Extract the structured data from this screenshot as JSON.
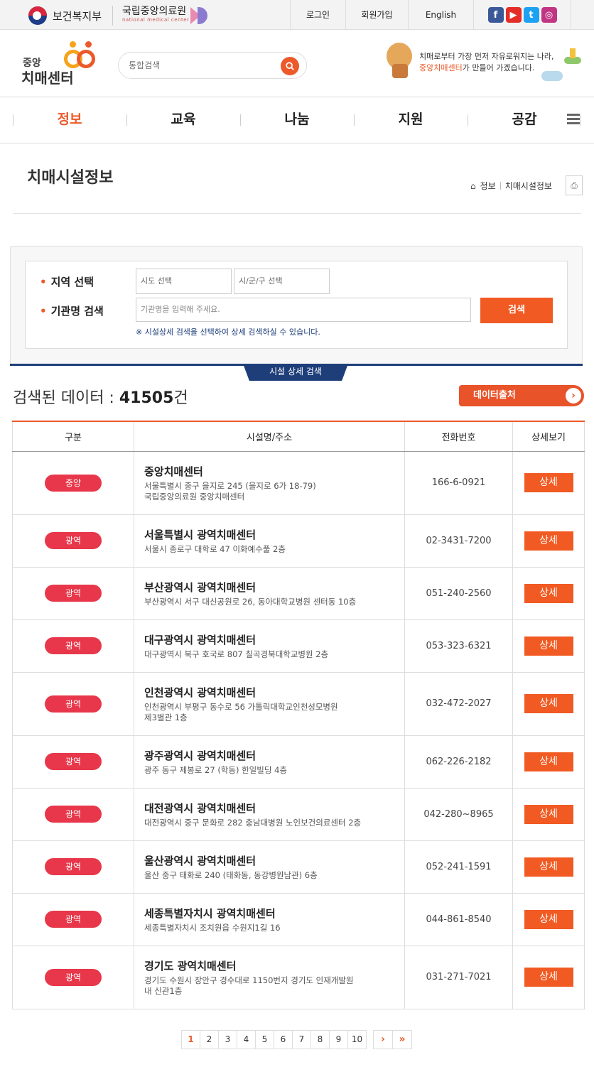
{
  "topbar": {
    "gov_name": "보건복지부",
    "nmc_name": "국립중앙의료원",
    "nmc_sub": "national medical center",
    "links": [
      "로그인",
      "회원가입",
      "English"
    ],
    "social": [
      {
        "icon": "facebook-icon",
        "glyph": "f"
      },
      {
        "icon": "youtube-icon",
        "glyph": "▶"
      },
      {
        "icon": "twitter-icon",
        "glyph": "t"
      },
      {
        "icon": "instagram-icon",
        "glyph": "◎"
      }
    ]
  },
  "header": {
    "logo_small": "중앙",
    "logo_big": "치매센터",
    "search_placeholder": "통합검색",
    "promo_line1": "치매로부터 가장 먼저 자유로워지는 나라,",
    "promo_highlight": "중앙치매센터",
    "promo_line2_rest": "가 만들어 가겠습니다."
  },
  "gnb": {
    "items": [
      "정보",
      "교육",
      "나눔",
      "지원",
      "공감"
    ],
    "active_index": 0
  },
  "page": {
    "title": "치매시설정보",
    "breadcrumb": [
      "정보",
      "치매시설정보"
    ]
  },
  "search_form": {
    "region_label": "지역 선택",
    "sido_placeholder": "시도 선택",
    "sigungu_placeholder": "시/군/구 선택",
    "org_label": "기관명 검색",
    "org_placeholder": "기관명을 입력해 주세요.",
    "search_button": "검색",
    "note": "※ 시설상세 검색을 선택하여 상세 검색하실 수 있습니다.",
    "detail_tab": "시설 상세 검색"
  },
  "results": {
    "count_prefix": "검색된 데이터 : ",
    "count_value": "41505",
    "count_suffix": "건",
    "export_label": "데이터출처",
    "columns": [
      "구분",
      "시설명/주소",
      "전화번호",
      "상세보기"
    ],
    "detail_label": "상세",
    "rows": [
      {
        "type": "중앙",
        "name": "중앙치매센터",
        "addr1": "서울특별시 중구 을지로 245 (을지로 6가 18-79)",
        "addr2": "국립중앙의료원 중앙치매센터",
        "phone": "166-6-0921"
      },
      {
        "type": "광역",
        "name": "서울특별시 광역치매센터",
        "addr1": "서울시 종로구 대학로 47 이화예수풀 2층",
        "addr2": "",
        "phone": "02-3431-7200"
      },
      {
        "type": "광역",
        "name": "부산광역시 광역치매센터",
        "addr1": "부산광역시 서구 대신공원로 26, 동아대학교병원 센터동 10층",
        "addr2": "",
        "phone": "051-240-2560"
      },
      {
        "type": "광역",
        "name": "대구광역시 광역치매센터",
        "addr1": "대구광역시 북구 호국로 807 칠곡경북대학교병원 2층",
        "addr2": "",
        "phone": "053-323-6321"
      },
      {
        "type": "광역",
        "name": "인천광역시 광역치매센터",
        "addr1": "인천광역시 부평구 동수로 56 가톨릭대학교인천성모병원",
        "addr2": "제3별관 1층",
        "phone": "032-472-2027"
      },
      {
        "type": "광역",
        "name": "광주광역시 광역치매센터",
        "addr1": "광주 동구 제봉로 27 (학동) 한일빌딩 4층",
        "addr2": "",
        "phone": "062-226-2182"
      },
      {
        "type": "광역",
        "name": "대전광역시 광역치매센터",
        "addr1": "대전광역시 중구 문화로 282 충남대병원 노인보건의료센터 2층",
        "addr2": "",
        "phone": "042-280~8965"
      },
      {
        "type": "광역",
        "name": "울산광역시 광역치매센터",
        "addr1": "울산 중구 태화로 240 (태화동, 동강병원남관) 6층",
        "addr2": "",
        "phone": "052-241-1591"
      },
      {
        "type": "광역",
        "name": "세종특별자치시 광역치매센터",
        "addr1": "세종특별자치시 조치원읍 수원지1길 16",
        "addr2": "",
        "phone": "044-861-8540"
      },
      {
        "type": "광역",
        "name": "경기도 광역치매센터",
        "addr1": "경기도 수원시 장안구 경수대로 1150번지 경기도 인재개발원",
        "addr2": "내 신관1층",
        "phone": "031-271-7021"
      }
    ]
  },
  "pagination": {
    "pages": [
      "1",
      "2",
      "3",
      "4",
      "5",
      "6",
      "7",
      "8",
      "9",
      "10"
    ],
    "current": "1",
    "next": "›",
    "last": "»"
  },
  "colors": {
    "accent": "#ec5a2b",
    "badge": "#e8374a",
    "navy": "#1e3e7a"
  }
}
